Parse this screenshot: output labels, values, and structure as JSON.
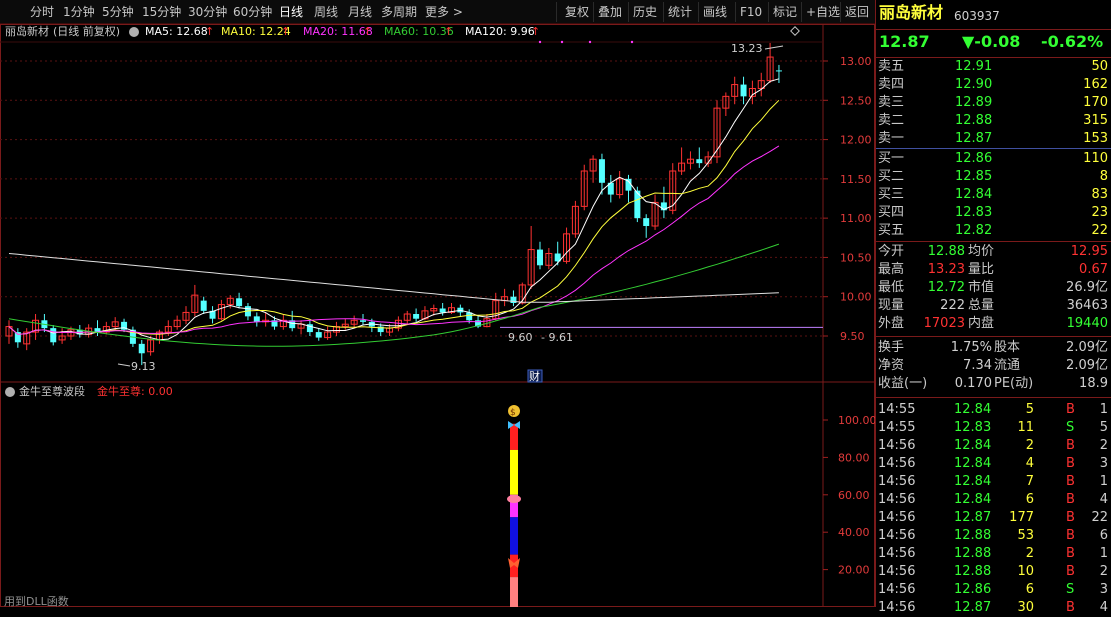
{
  "nav_period": [
    "分时",
    "1分钟",
    "5分钟",
    "15分钟",
    "30分钟",
    "60分钟",
    "日线",
    "周线",
    "月线",
    "多周期",
    "更多 >"
  ],
  "nav_right": [
    "复权",
    "叠加",
    "历史",
    "统计",
    "画线",
    "F10",
    "标记",
    "+自选",
    "返回"
  ],
  "main_chart": {
    "name": "丽岛新材",
    "mode": "(日线 前复权)",
    "ma": [
      {
        "label": "MA5: 12.68",
        "color": "#ffffff"
      },
      {
        "label": "MA10: 12.24",
        "color": "#ffff3c"
      },
      {
        "label": "MA20: 11.68",
        "color": "#ff33ff"
      },
      {
        "label": "MA60: 10.36",
        "color": "#33cc33"
      },
      {
        "label": "MA120: 9.96",
        "color": "#ffffff"
      }
    ],
    "price_ticks": [
      "13.00",
      "12.50",
      "12.00",
      "11.50",
      "11.00",
      "10.50",
      "10.00",
      "9.50"
    ],
    "annotations": {
      "high": "13.23",
      "low": "9.13",
      "mid_low": "9.60",
      "mid_low2": "9.61",
      "finance_marker": "财"
    }
  },
  "indicator": {
    "name": "金牛至尊波段",
    "value_label": "金牛至尊: 0.00",
    "ticks": [
      "100.00",
      "80.00",
      "60.00",
      "40.00",
      "20.00"
    ],
    "footer": "用到DLL函数"
  },
  "quote": {
    "name": "丽岛新材",
    "code": "603937",
    "price": "12.87",
    "change": "▼-0.08",
    "change_pct": "-0.62%"
  },
  "asks": [
    {
      "label": "卖五",
      "price": "12.91",
      "vol": "50"
    },
    {
      "label": "卖四",
      "price": "12.90",
      "vol": "162"
    },
    {
      "label": "卖三",
      "price": "12.89",
      "vol": "170"
    },
    {
      "label": "卖二",
      "price": "12.88",
      "vol": "315"
    },
    {
      "label": "卖一",
      "price": "12.87",
      "vol": "153"
    }
  ],
  "bids": [
    {
      "label": "买一",
      "price": "12.86",
      "vol": "110"
    },
    {
      "label": "买二",
      "price": "12.85",
      "vol": "8"
    },
    {
      "label": "买三",
      "price": "12.84",
      "vol": "83"
    },
    {
      "label": "买四",
      "price": "12.83",
      "vol": "23"
    },
    {
      "label": "买五",
      "price": "12.82",
      "vol": "22"
    }
  ],
  "stats": [
    {
      "l1": "今开",
      "v1": "12.88",
      "l2": "均价",
      "v2": "12.95"
    },
    {
      "l1": "最高",
      "v1": "13.23",
      "l2": "量比",
      "v2": "0.67"
    },
    {
      "l1": "最低",
      "v1": "12.72",
      "l2": "市值",
      "v2": "26.9亿"
    },
    {
      "l1": "现量",
      "v1": "222",
      "l2": "总量",
      "v2": "36463"
    },
    {
      "l1": "外盘",
      "v1": "17023",
      "l2": "内盘",
      "v2": "19440"
    }
  ],
  "stats2": [
    {
      "l1": "换手",
      "v1": "1.75%",
      "l2": "股本",
      "v2": "2.09亿"
    },
    {
      "l1": "净资",
      "v1": "7.34",
      "l2": "流通",
      "v2": "2.09亿"
    },
    {
      "l1": "收益(一)",
      "v1": "0.170",
      "l2": "PE(动)",
      "v2": "18.9"
    }
  ],
  "trades": [
    {
      "time": "14:55",
      "price": "12.84",
      "vol": "5",
      "side": "B",
      "n": "1"
    },
    {
      "time": "14:55",
      "price": "12.83",
      "vol": "11",
      "side": "S",
      "n": "5"
    },
    {
      "time": "14:56",
      "price": "12.84",
      "vol": "2",
      "side": "B",
      "n": "2"
    },
    {
      "time": "14:56",
      "price": "12.84",
      "vol": "4",
      "side": "B",
      "n": "3"
    },
    {
      "time": "14:56",
      "price": "12.84",
      "vol": "7",
      "side": "B",
      "n": "1"
    },
    {
      "time": "14:56",
      "price": "12.84",
      "vol": "6",
      "side": "B",
      "n": "4"
    },
    {
      "time": "14:56",
      "price": "12.87",
      "vol": "177",
      "side": "B",
      "n": "22"
    },
    {
      "time": "14:56",
      "price": "12.88",
      "vol": "53",
      "side": "B",
      "n": "6"
    },
    {
      "time": "14:56",
      "price": "12.88",
      "vol": "2",
      "side": "B",
      "n": "1"
    },
    {
      "time": "14:56",
      "price": "12.88",
      "vol": "10",
      "side": "B",
      "n": "2"
    },
    {
      "time": "14:56",
      "price": "12.86",
      "vol": "6",
      "side": "S",
      "n": "3"
    },
    {
      "time": "14:56",
      "price": "12.87",
      "vol": "30",
      "side": "B",
      "n": "4"
    }
  ]
}
